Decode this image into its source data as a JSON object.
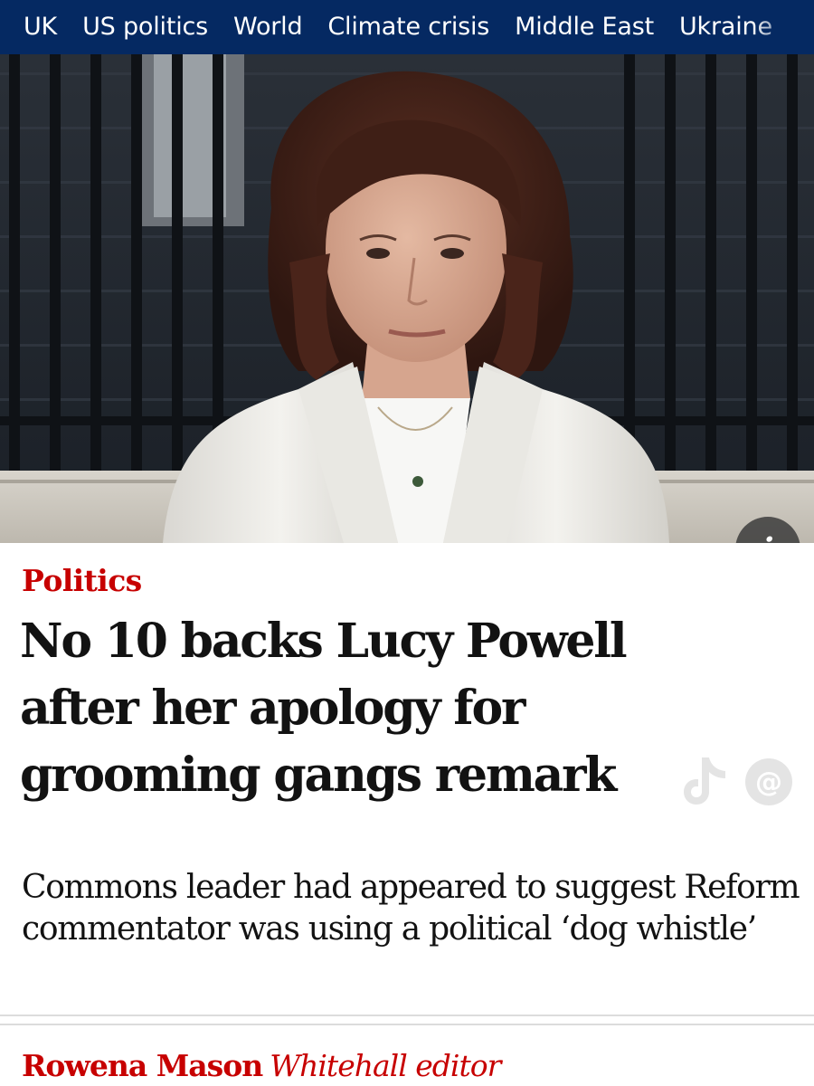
{
  "nav": {
    "items": [
      "UK",
      "US politics",
      "World",
      "Climate crisis",
      "Middle East",
      "Ukraine"
    ],
    "background_color": "#052962"
  },
  "hero": {
    "info_button_icon": "info-icon",
    "info_button_glyph": "i"
  },
  "article": {
    "section": "Politics",
    "headline": "No 10 backs Lucy Powell after her apology for grooming gangs remark",
    "standfirst": "Commons leader had appeared to suggest Reform commentator was using a political ‘dog whistle’",
    "byline_author": "Rowena Mason",
    "byline_role": "Whitehall editor",
    "accent_color": "#c70000"
  },
  "overlay": {
    "icons": [
      "tiktok-logo-icon",
      "at-sign-icon"
    ]
  }
}
